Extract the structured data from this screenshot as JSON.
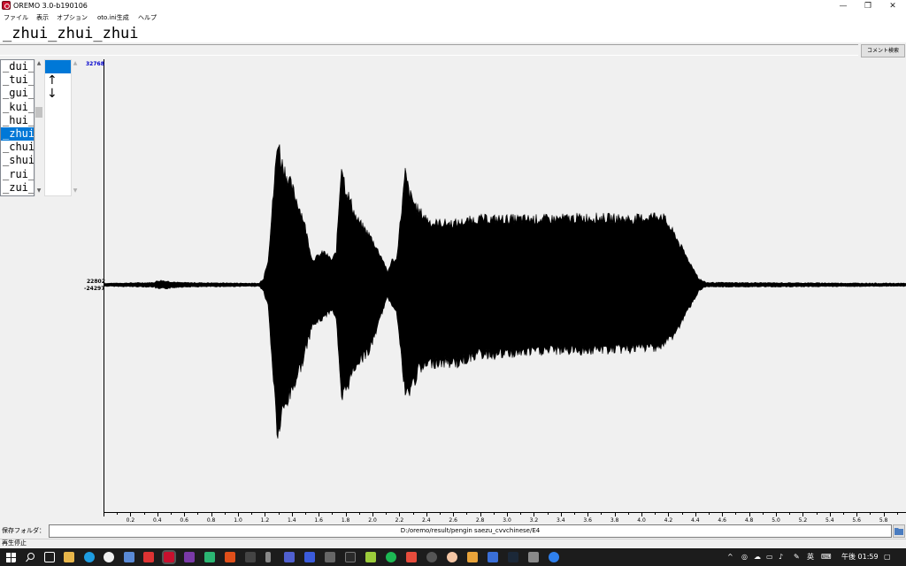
{
  "window": {
    "title": "OREMO 3.0-b190106",
    "minimize_glyph": "—",
    "maximize_glyph": "❐",
    "close_glyph": "✕"
  },
  "menu": {
    "items": [
      "ファイル",
      "表示",
      "オプション",
      "oto.ini生成",
      "ヘルプ"
    ]
  },
  "alias": {
    "current": "_zhui_zhui_zhui",
    "comment_value": "",
    "comment_search_label": "コメント検索"
  },
  "alias_list": {
    "items": [
      "_dui_",
      "_tui_",
      "_gui_",
      "_kui_",
      "_hui_",
      "_zhui",
      "_chui",
      "_shui",
      "_rui_",
      "_zui_"
    ],
    "selected_index": 5
  },
  "suffix_list": {
    "items": [
      "",
      "↑",
      "↓"
    ],
    "selected_index": 0
  },
  "waveform": {
    "y_max_label": "32768",
    "y_mid_upper_label": "22802",
    "y_mid_lower_label": "-24297",
    "time_ticks": [
      "0.2",
      "0.4",
      "0.6",
      "0.8",
      "1.0",
      "1.2",
      "1.4",
      "1.6",
      "1.8",
      "2.0",
      "2.2",
      "2.4",
      "2.6",
      "2.8",
      "3.0",
      "3.2",
      "3.4",
      "3.6",
      "3.8",
      "4.0",
      "4.2",
      "4.4",
      "4.6",
      "4.8",
      "5.0",
      "5.2",
      "5.4",
      "5.6",
      "5.8"
    ],
    "colors": {
      "wave": "#000000",
      "max_label": "#0000cc",
      "selection": "#0078d7"
    }
  },
  "folder": {
    "label": "保存フォルダ：",
    "path": "D:/oremo/result/pengin saezu_cvvchinese/E4"
  },
  "status": {
    "text": "再生停止"
  },
  "taskbar": {
    "ime": "英",
    "time": "午後 01:59",
    "start_icon": "windows-start-icon",
    "search_icon": "search-icon"
  }
}
